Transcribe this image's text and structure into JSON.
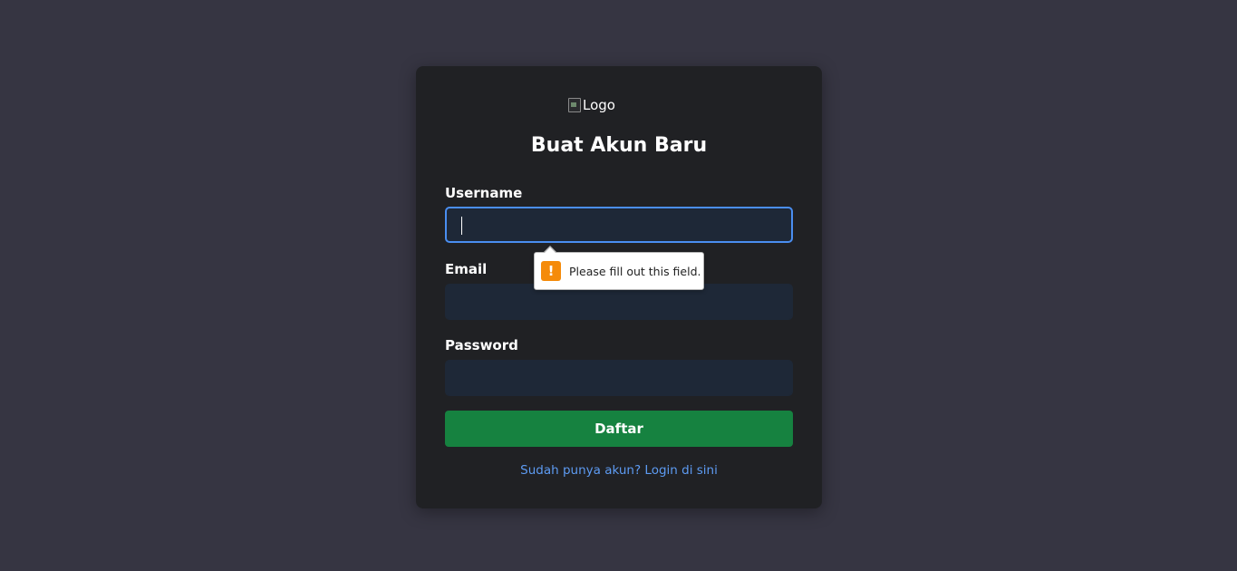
{
  "form": {
    "logo_alt": "Logo",
    "title": "Buat Akun Baru",
    "username_label": "Username",
    "email_label": "Email",
    "password_label": "Password",
    "username_value": "",
    "email_value": "",
    "password_value": "",
    "submit_label": "Daftar",
    "login_link": "Sudah punya akun? Login di sini"
  },
  "validation": {
    "icon": "!",
    "message": "Please fill out this field."
  },
  "colors": {
    "page_bg": "#363542",
    "card_bg": "#202124",
    "input_bg": "#1e2837",
    "focus_border": "#4a8ef0",
    "button_bg": "#168240",
    "link": "#5d9bf2",
    "warning": "#f58b0a"
  },
  "icons": {
    "logo": "broken-image-icon",
    "validation": "warning-icon"
  }
}
